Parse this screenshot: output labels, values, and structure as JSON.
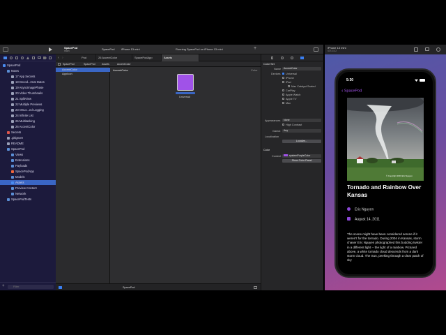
{
  "xcode": {
    "project_title": "SpacePod",
    "branch": "main",
    "scheme_app": "SpacePod",
    "scheme_device": "iPhone 13 mini",
    "activity": "Running SpacePod on iPhone 13 mini",
    "tabs": [
      "Pod",
      "26 AccentColor",
      "SpacePodApp",
      "Assets"
    ],
    "breadcrumbs": [
      "SpacePod",
      "SpacePod",
      "Assets",
      "AccentColor"
    ],
    "navigator": [
      {
        "label": "SpacePod",
        "indent": 0,
        "icon": "project-icon",
        "color": "#4a8cf0"
      },
      {
        "label": "Notes",
        "indent": 1,
        "icon": "folder-icon",
        "color": "#5b8fd6"
      },
      {
        "label": "17 App Secrets",
        "indent": 2,
        "icon": "file-icon",
        "color": "#9aa0b8"
      },
      {
        "label": "18 Decod...rmat Dates",
        "indent": 2,
        "icon": "file-icon",
        "color": "#9aa0b8"
      },
      {
        "label": "19 AsyncImagePhase",
        "indent": 2,
        "icon": "file-icon",
        "color": "#9aa0b8"
      },
      {
        "label": "20 Video Thumbnails",
        "indent": 2,
        "icon": "file-icon",
        "color": "#9aa0b8"
      },
      {
        "label": "21 SplitView",
        "indent": 2,
        "icon": "file-icon",
        "color": "#9aa0b8"
      },
      {
        "label": "22 Multiple Previews",
        "indent": 2,
        "icon": "file-icon",
        "color": "#9aa0b8"
      },
      {
        "label": "23 OSLo...ed Logging",
        "indent": 2,
        "icon": "file-icon",
        "color": "#9aa0b8"
      },
      {
        "label": "24 Infinite List",
        "indent": 2,
        "icon": "file-icon",
        "color": "#9aa0b8"
      },
      {
        "label": "25 Multitasking",
        "indent": 2,
        "icon": "file-icon",
        "color": "#9aa0b8"
      },
      {
        "label": "26 AccentColor",
        "indent": 2,
        "icon": "file-icon",
        "color": "#9aa0b8"
      },
      {
        "label": "Secrets",
        "indent": 1,
        "icon": "secrets-icon",
        "color": "#e0564b"
      },
      {
        "label": ".gitignore",
        "indent": 1,
        "icon": "file-icon",
        "color": "#9aa0b8"
      },
      {
        "label": "README",
        "indent": 1,
        "icon": "file-icon",
        "color": "#9aa0b8"
      },
      {
        "label": "SpacePod",
        "indent": 1,
        "icon": "folder-icon",
        "color": "#5b8fd6"
      },
      {
        "label": "Views",
        "indent": 2,
        "icon": "folder-icon",
        "color": "#5b8fd6"
      },
      {
        "label": "Extensions",
        "indent": 2,
        "icon": "folder-icon",
        "color": "#5b8fd6"
      },
      {
        "label": "Payloads",
        "indent": 2,
        "icon": "folder-icon",
        "color": "#5b8fd6"
      },
      {
        "label": "SpacePodApp",
        "indent": 2,
        "icon": "swift-icon",
        "color": "#f0663c"
      },
      {
        "label": "Models",
        "indent": 2,
        "icon": "folder-icon",
        "color": "#5b8fd6"
      },
      {
        "label": "Assets",
        "indent": 2,
        "icon": "assets-icon",
        "color": "#4a8cf0",
        "selected": true
      },
      {
        "label": "Preview Content",
        "indent": 2,
        "icon": "folder-icon",
        "color": "#5b8fd6"
      },
      {
        "label": "Network",
        "indent": 2,
        "icon": "folder-icon",
        "color": "#5b8fd6"
      },
      {
        "label": "SpacePodTests",
        "indent": 1,
        "icon": "folder-icon",
        "color": "#5b8fd6"
      }
    ],
    "filter_placeholder": "Filter",
    "assets": [
      "AccentColor",
      "AppIcon"
    ],
    "canvas_title": "AccentColor",
    "canvas_right_label": "Color",
    "swatch_color": "#a052e8",
    "swatch_label": "Universal",
    "inspector": {
      "section1": "Color Set",
      "name_label": "Name",
      "name_value": "AccentColor",
      "devices_label": "Devices",
      "devices": [
        {
          "label": "Universal",
          "checked": true
        },
        {
          "label": "iPhone",
          "checked": false
        },
        {
          "label": "iPad",
          "checked": false
        },
        {
          "label": "Mac Catalyst Scaled",
          "checked": false
        },
        {
          "label": "CarPlay",
          "checked": false
        },
        {
          "label": "Apple Watch",
          "checked": false
        },
        {
          "label": "Apple TV",
          "checked": false
        },
        {
          "label": "Mac",
          "checked": false
        }
      ],
      "appearances_label": "Appearances",
      "appearances_value": "None",
      "high_contrast": "High Contrast",
      "gamut_label": "Gamut",
      "gamut_value": "Any",
      "localization_label": "Localization",
      "localize_button": "Localize...",
      "section2": "Color",
      "content_label": "Content",
      "content_value": "systemPurpleColor",
      "panel_button": "Show Color Panel"
    },
    "status_scheme": "SpacePod"
  },
  "simulator": {
    "device": "iPhone 13 mini",
    "os": "iOS 15.2",
    "time": "5:30",
    "back_label": "SpacePod",
    "photo_credit": "© Copyright 2004 Eric Nguyen",
    "article_title": "Tornado and Rainbow Over Kansas",
    "author": "Eric Nguyen",
    "date": "August 14, 2011",
    "body": "The scene might have been considered serene if it weren't for the tornado. During 2004 in Kansas, storm chaser Eric Nguyen photographed this budding twister in a different light -- the light of a rainbow. Pictured above, a white tornado cloud descends from a dark storm cloud.  The Sun, peeking through a clear patch of sky",
    "accent_color": "#a052e8"
  }
}
